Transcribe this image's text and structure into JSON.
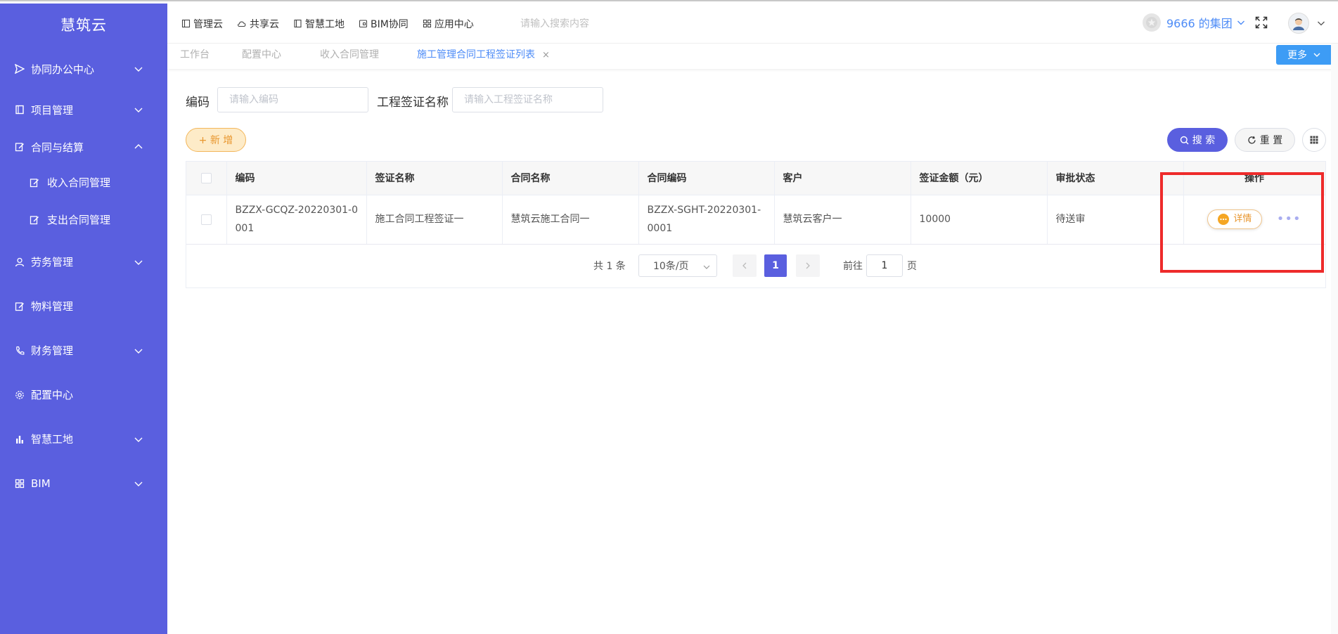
{
  "sidebar": {
    "logo": "慧筑云",
    "items": [
      {
        "label": "协同办公中心",
        "icon": "send-icon",
        "chevron": "down"
      },
      {
        "label": "项目管理",
        "icon": "book-icon",
        "chevron": "down"
      },
      {
        "label": "合同与结算",
        "icon": "edit-icon",
        "chevron": "up"
      },
      {
        "label": "收入合同管理",
        "icon": "edit-icon",
        "sub": true
      },
      {
        "label": "支出合同管理",
        "icon": "edit-icon",
        "sub": true
      },
      {
        "label": "劳务管理",
        "icon": "user-icon",
        "chevron": "down"
      },
      {
        "label": "物料管理",
        "icon": "edit-icon",
        "chevron": ""
      },
      {
        "label": "财务管理",
        "icon": "phone-icon",
        "chevron": "down"
      },
      {
        "label": "配置中心",
        "icon": "gear-icon",
        "chevron": ""
      },
      {
        "label": "智慧工地",
        "icon": "bar-chart-icon",
        "chevron": "down"
      },
      {
        "label": "BIM",
        "icon": "grid-icon",
        "chevron": "down"
      }
    ]
  },
  "header": {
    "nav": [
      {
        "label": "管理云",
        "icon": "panel-icon"
      },
      {
        "label": "共享云",
        "icon": "cloud-icon"
      },
      {
        "label": "智慧工地",
        "icon": "book-icon"
      },
      {
        "label": "BIM协同",
        "icon": "cube-icon"
      },
      {
        "label": "应用中心",
        "icon": "apps-icon"
      }
    ],
    "search_placeholder": "请输入搜索内容",
    "org_name": "9666 的集团"
  },
  "tabs": [
    {
      "label": "工作台",
      "active": false
    },
    {
      "label": "配置中心",
      "active": false
    },
    {
      "label": "收入合同管理",
      "active": false
    },
    {
      "label": "施工管理合同工程签证列表",
      "active": true,
      "close": "×"
    }
  ],
  "more_label": "更多",
  "filters": {
    "code_label": "编码",
    "code_placeholder": "请输入编码",
    "name_label": "工程签证名称",
    "name_placeholder": "请输入工程签证名称"
  },
  "actions": {
    "add": "+ 新 增",
    "search": "搜 索",
    "reset": "重 置"
  },
  "table": {
    "columns": [
      "编码",
      "签证名称",
      "合同名称",
      "合同编码",
      "客户",
      "签证金额（元）",
      "审批状态",
      "操作"
    ],
    "rows": [
      {
        "code": "BZZX-GCQZ-20220301-0001",
        "visa_name": "施工合同工程签证一",
        "contract_name": "慧筑云施工合同一",
        "contract_code": "BZZX-SGHT-20220301-0001",
        "customer": "慧筑云客户一",
        "amount": "10000",
        "status": "待送审",
        "detail_label": "详情",
        "more": "•••"
      }
    ]
  },
  "pagination": {
    "total": "共 1 条",
    "page_size": "10条/页",
    "current": "1",
    "goto_label": "前往",
    "goto_value": "1",
    "page_unit": "页"
  },
  "colors": {
    "sidebar_bg": "#5a5fdf",
    "accent_blue": "#4e8cf7",
    "more_btn": "#3d9cf5",
    "add_btn_text": "#e8962e",
    "highlight": "#ee2b2b"
  }
}
